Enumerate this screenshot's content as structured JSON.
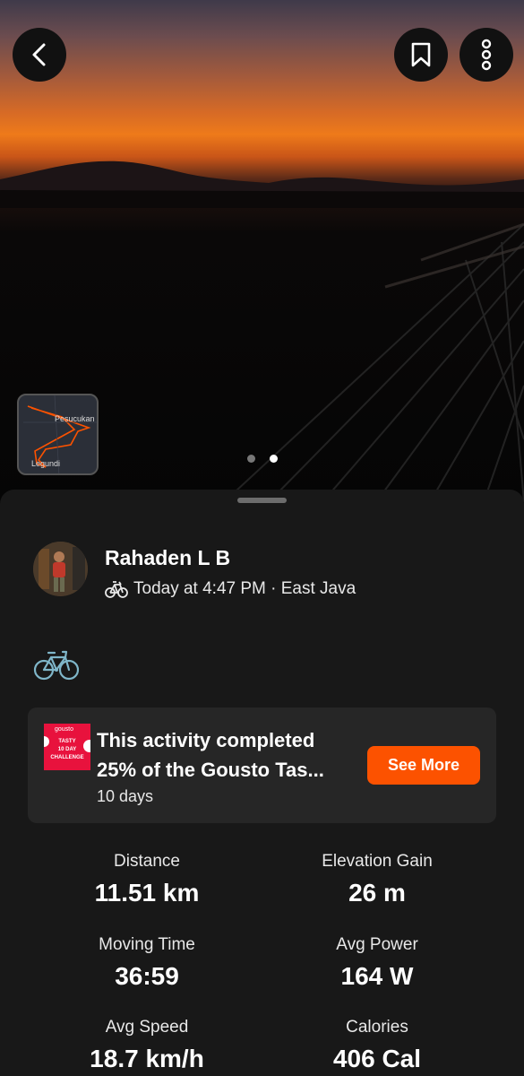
{
  "header": {
    "back_icon": "chevron-left-icon",
    "bookmark_icon": "bookmark-icon",
    "more_icon": "more-vertical-icon"
  },
  "map_thumbnail": {
    "label_top": "Pesucukan",
    "label_bottom": "Legundi",
    "route_color": "#fc5200"
  },
  "carousel": {
    "page_count": 2,
    "active_index": 1
  },
  "activity": {
    "athlete_name": "Rahaden L B",
    "ride_icon": "bike-icon",
    "meta_text": "Today at 4:47 PM · East Java",
    "sport_icon": "bicycle-icon"
  },
  "challenge": {
    "logo_brand": "gousto",
    "logo_lines": [
      "TASTY",
      "10 DAY",
      "CHALLENGE"
    ],
    "title_line1": "This activity completed",
    "title_line2": "25% of the Gousto Tas...",
    "subtitle": "10 days",
    "button_label": "See More",
    "accent_color": "#fc5200"
  },
  "stats": [
    {
      "label": "Distance",
      "value": "11.51 km"
    },
    {
      "label": "Elevation Gain",
      "value": "26 m"
    },
    {
      "label": "Moving Time",
      "value": "36:59"
    },
    {
      "label": "Avg Power",
      "value": "164 W"
    },
    {
      "label": "Avg Speed",
      "value": "18.7 km/h"
    },
    {
      "label": "Calories",
      "value": "406 Cal"
    }
  ]
}
